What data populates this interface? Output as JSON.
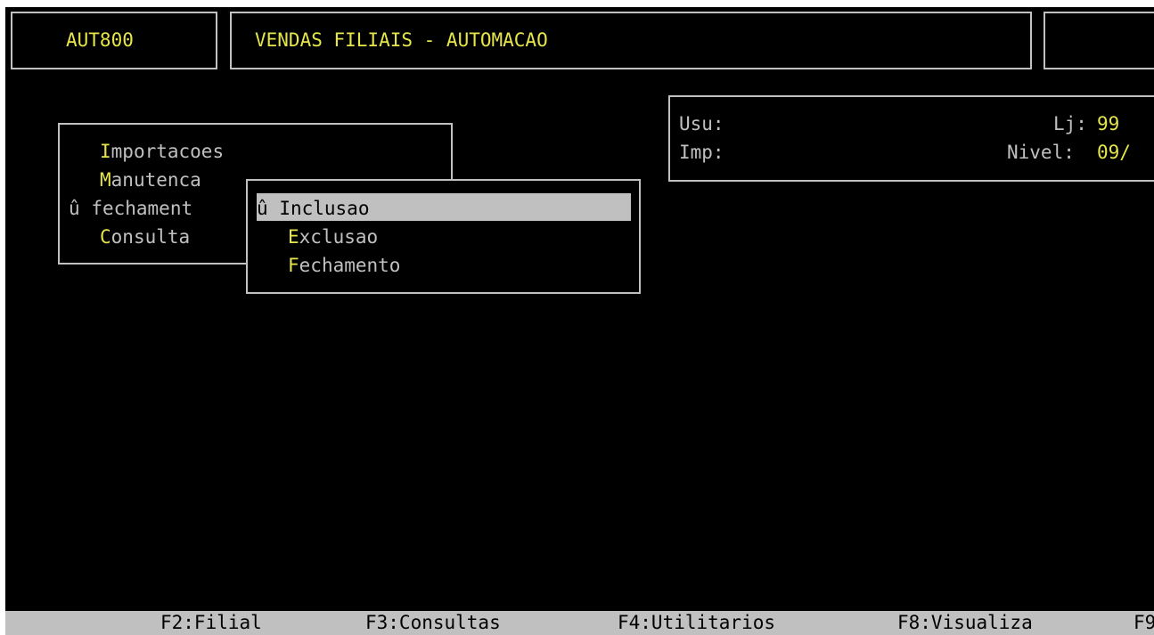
{
  "header": {
    "program_code": "AUT800",
    "title": "VENDAS FILIAIS - AUTOMACAO"
  },
  "info_panel": {
    "usu_label": "Usu:",
    "imp_label": "Imp:",
    "lj_label": "Lj:",
    "lj_value": "99",
    "nivel_label": "Nivel:",
    "nivel_value": "09/"
  },
  "main_menu": {
    "items": [
      {
        "hotkey": "I",
        "rest": "mportacoes",
        "marker": ""
      },
      {
        "hotkey": "M",
        "rest": "anutenca",
        "marker": ""
      },
      {
        "hotkey": "",
        "rest": "fechament",
        "marker": "û"
      },
      {
        "hotkey": "C",
        "rest": "onsulta",
        "marker": ""
      }
    ]
  },
  "sub_menu": {
    "items": [
      {
        "hotkey": "",
        "label": "Inclusao",
        "marker": "û",
        "selected": true
      },
      {
        "hotkey": "E",
        "rest": "xclusao",
        "marker": ""
      },
      {
        "hotkey": "F",
        "rest": "echamento",
        "marker": ""
      }
    ]
  },
  "function_keys": [
    {
      "label": "F2:Filial"
    },
    {
      "label": "F3:Consultas"
    },
    {
      "label": "F4:Utilitarios"
    },
    {
      "label": "F8:Visualiza"
    },
    {
      "label": "F9"
    }
  ],
  "colors": {
    "background": "#000000",
    "text": "#c0c0c0",
    "highlight": "#e6e64a",
    "selection_bar": "#c0c0c0"
  }
}
